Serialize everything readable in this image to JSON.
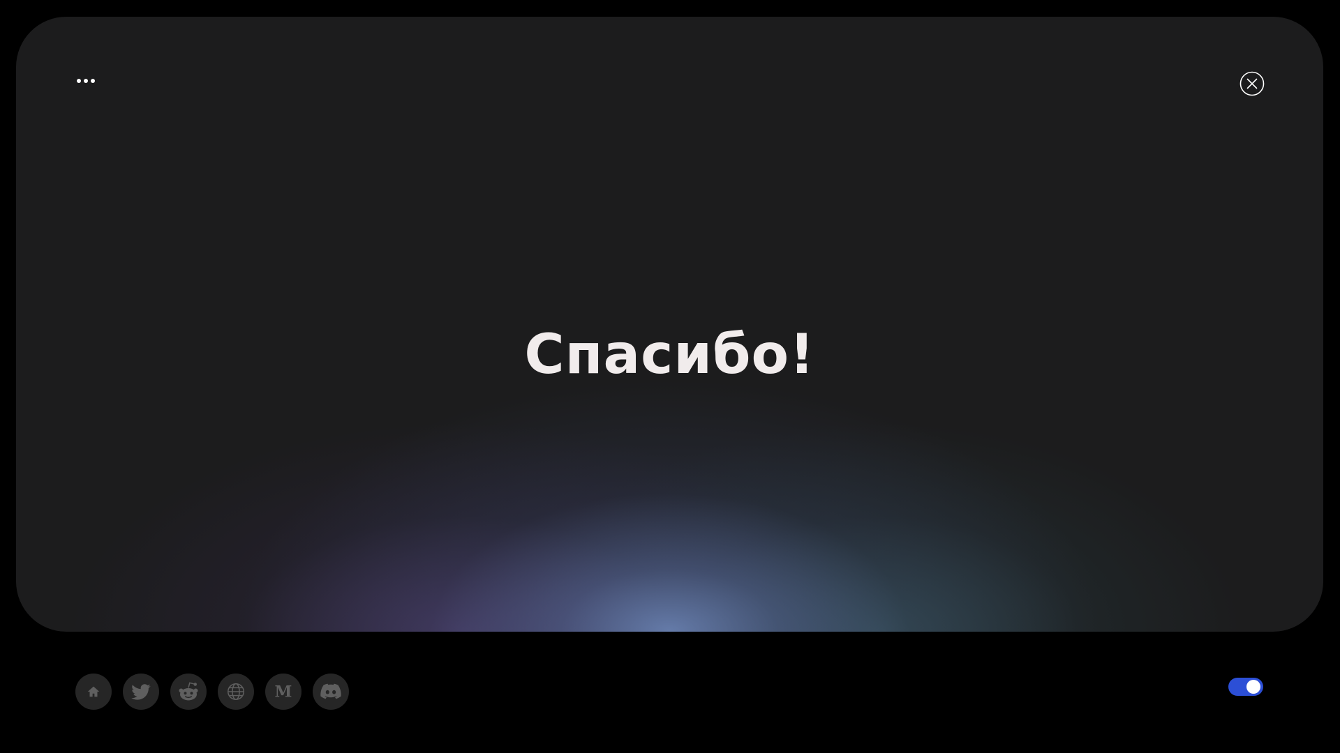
{
  "dialog": {
    "title": "Спасибо!"
  },
  "icons": {
    "menu": "more-horizontal-icon",
    "close": "close-circle-icon"
  },
  "social_links": [
    {
      "icon": "home-icon"
    },
    {
      "icon": "twitter-icon"
    },
    {
      "icon": "reddit-icon"
    },
    {
      "icon": "globe-icon"
    },
    {
      "icon": "medium-icon"
    },
    {
      "icon": "discord-icon"
    }
  ],
  "toggle": {
    "state": "on",
    "color": "#2c4fd6"
  },
  "colors": {
    "background": "#000000",
    "card": "#1c1c1d",
    "title_text": "#f1ecec",
    "icon_button": "#262626",
    "icon_glyph": "#5f5f5f"
  }
}
